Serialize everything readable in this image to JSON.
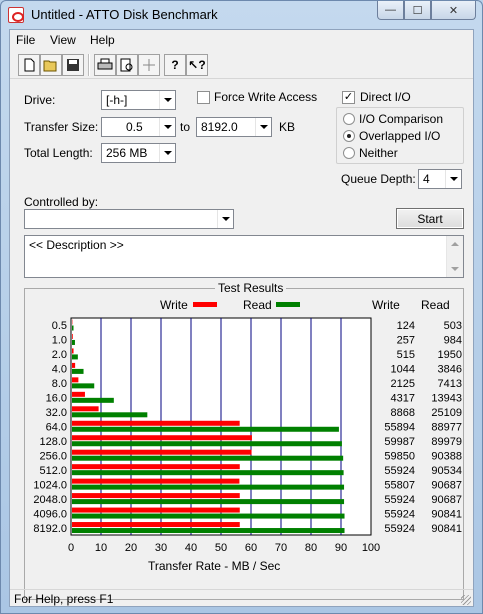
{
  "window": {
    "title": "Untitled - ATTO Disk Benchmark"
  },
  "menu": {
    "items": [
      "File",
      "View",
      "Help"
    ]
  },
  "toolbar": {
    "icons": [
      "new-icon",
      "open-icon",
      "save-icon",
      "print-icon",
      "print-preview-icon",
      "move-icon",
      "help-icon",
      "context-help-icon"
    ]
  },
  "form": {
    "drive_label": "Drive:",
    "drive_value": "[-h-]",
    "force_write_label": "Force Write Access",
    "force_write_checked": false,
    "direct_io_label": "Direct I/O",
    "direct_io_checked": true,
    "transfer_size_label": "Transfer Size:",
    "transfer_from": "0.5",
    "to_label": "to",
    "transfer_to": "8192.0",
    "kb_label": "KB",
    "total_length_label": "Total Length:",
    "total_length_value": "256 MB",
    "io_comparison_label": "I/O Comparison",
    "overlapped_io_label": "Overlapped I/O",
    "neither_label": "Neither",
    "selected_mode": "Overlapped I/O",
    "queue_depth_label": "Queue Depth:",
    "queue_depth_value": "4",
    "controlled_by_label": "Controlled by:",
    "controlled_by_value": "",
    "start_label": "Start",
    "description_text": "<< Description >>"
  },
  "results": {
    "title": "Test Results",
    "write_legend": "Write",
    "read_legend": "Read",
    "write_header": "Write",
    "read_header": "Read"
  },
  "chart_data": {
    "type": "bar",
    "orientation": "horizontal",
    "categories": [
      "0.5",
      "1.0",
      "2.0",
      "4.0",
      "8.0",
      "16.0",
      "32.0",
      "64.0",
      "128.0",
      "256.0",
      "512.0",
      "1024.0",
      "2048.0",
      "4096.0",
      "8192.0"
    ],
    "series": [
      {
        "name": "Write",
        "color": "#ff0000",
        "values": [
          124,
          257,
          515,
          1044,
          2125,
          4317,
          8868,
          55894,
          59987,
          59850,
          55924,
          55807,
          55924,
          55924,
          55924
        ]
      },
      {
        "name": "Read",
        "color": "#008000",
        "values": [
          503,
          984,
          1950,
          3846,
          7413,
          13943,
          25109,
          88977,
          89979,
          90388,
          90534,
          90687,
          90687,
          90841,
          90841
        ]
      }
    ],
    "xlabel": "Transfer Rate - MB / Sec",
    "x_ticks": [
      "0",
      "10",
      "20",
      "30",
      "40",
      "50",
      "60",
      "70",
      "80",
      "90",
      "100"
    ],
    "xlim": [
      0,
      100
    ],
    "value_unit_divisor": 1000,
    "grid": true,
    "legend_position": "top"
  },
  "status": {
    "text": "For Help, press F1"
  },
  "colors": {
    "write": "#ff0000",
    "read": "#008000",
    "grid": "#000080"
  }
}
